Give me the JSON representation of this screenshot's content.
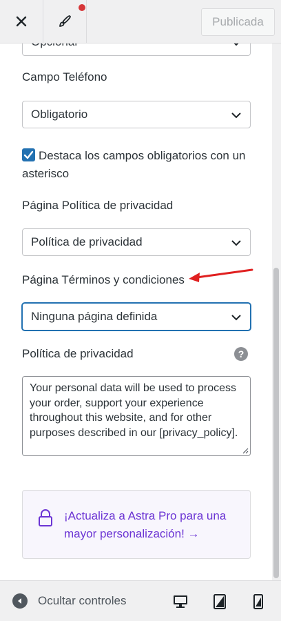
{
  "topbar": {
    "publish_label": "Publicada"
  },
  "fields": {
    "cut_off_value": "Opcional",
    "phone_label": "Campo Teléfono",
    "phone_value": "Obligatorio",
    "asterisk_checkbox_label": "Destaca los campos obligatorios con un asterisco",
    "asterisk_checked": true,
    "privacy_page_label": "Página Política de privacidad",
    "privacy_page_value": "Política de privacidad",
    "terms_page_label": "Página Términos y condiciones",
    "terms_page_value": "Ninguna página definida",
    "privacy_text_label": "Política de privacidad",
    "privacy_text_value": "Your personal data will be used to process your order, support your experience throughout this website, and for other purposes described in our [privacy_policy].",
    "help_glyph": "?"
  },
  "upsell": {
    "text": "¡Actualiza a Astra Pro para una mayor personalización! →",
    "icon": "lock-icon"
  },
  "footer": {
    "hide_controls_label": "Ocultar controles",
    "devices": [
      "desktop-icon",
      "tablet-icon",
      "mobile-icon"
    ]
  },
  "colors": {
    "accent": "#2271b1",
    "upsell_text": "#6b34d4",
    "annotation_arrow": "#e02020",
    "notification_dot": "#d63638"
  }
}
